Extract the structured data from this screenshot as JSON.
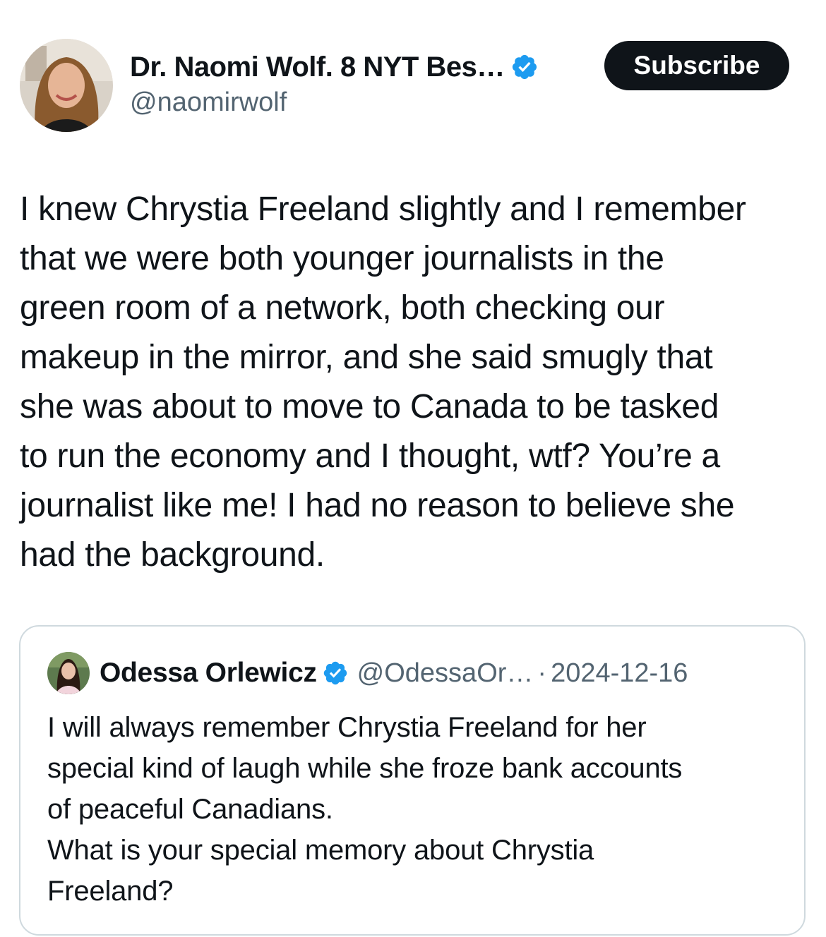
{
  "author": {
    "display_name": "Dr. Naomi Wolf. 8 NYT Bes…",
    "handle": "@naomirwolf",
    "verified": true,
    "avatar_icon": "profile-photo"
  },
  "actions": {
    "subscribe_label": "Subscribe"
  },
  "tweet": {
    "text": "I knew Chrystia Freeland slightly and I remember\nthat we were both younger journalists in the\ngreen room of a network, both checking our\nmakeup in the mirror, and she said smugly that\nshe was about to move to Canada to be tasked\nto run the economy and I thought, wtf? You’re a\njournalist like me! I had no reason to believe she\nhad the background."
  },
  "quoted_tweet": {
    "display_name": "Odessa Orlewicz",
    "handle": "@OdessaOr…",
    "separator": "·",
    "date": "2024-12-16",
    "verified": true,
    "text": "I will always remember Chrystia Freeland for her\nspecial kind of laugh while she froze bank accounts\nof peaceful Canadians.\nWhat is your special memory about Chrystia\nFreeland?"
  },
  "colors": {
    "verified_badge": "#1d9bf0",
    "text_primary": "#0f1419",
    "text_secondary": "#536471",
    "button_bg": "#0f1419",
    "card_border": "#cfd9de"
  }
}
